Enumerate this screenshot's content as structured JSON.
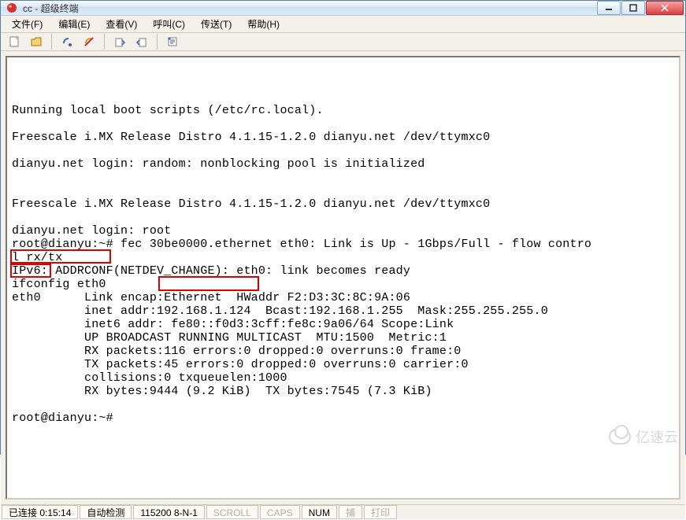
{
  "window": {
    "title": "cc - 超级终端"
  },
  "menu": {
    "file": "文件(F)",
    "edit": "编辑(E)",
    "view": "查看(V)",
    "call": "呼叫(C)",
    "transfer": "传送(T)",
    "help": "帮助(H)"
  },
  "toolbar_icons": {
    "new": "new-icon",
    "open": "open-icon",
    "connect": "connect-icon",
    "disconnect": "disconnect-icon",
    "send": "send-icon",
    "receive": "receive-icon",
    "properties": "properties-icon"
  },
  "terminal": {
    "lines": [
      "",
      "Running local boot scripts (/etc/rc.local).",
      "",
      "Freescale i.MX Release Distro 4.1.15-1.2.0 dianyu.net /dev/ttymxc0",
      "",
      "dianyu.net login: random: nonblocking pool is initialized",
      "",
      "",
      "Freescale i.MX Release Distro 4.1.15-1.2.0 dianyu.net /dev/ttymxc0",
      "",
      "dianyu.net login: root",
      "root@dianyu:~# fec 30be0000.ethernet eth0: Link is Up - 1Gbps/Full - flow contro",
      "l rx/tx",
      "IPv6: ADDRCONF(NETDEV_CHANGE): eth0: link becomes ready",
      "ifconfig eth0",
      "eth0      Link encap:Ethernet  HWaddr F2:D3:3C:8C:9A:06",
      "          inet addr:192.168.1.124  Bcast:192.168.1.255  Mask:255.255.255.0",
      "          inet6 addr: fe80::f0d3:3cff:fe8c:9a06/64 Scope:Link",
      "          UP BROADCAST RUNNING MULTICAST  MTU:1500  Metric:1",
      "          RX packets:116 errors:0 dropped:0 overruns:0 frame:0",
      "          TX packets:45 errors:0 dropped:0 overruns:0 carrier:0",
      "          collisions:0 txqueuelen:1000",
      "          RX bytes:9444 (9.2 KiB)  TX bytes:7545 (7.3 KiB)",
      "",
      "root@dianyu:~#"
    ],
    "highlights": {
      "ifconfig_cmd": "ifconfig eth0",
      "interface": "eth0",
      "ip_addr": "192.168.1.124"
    }
  },
  "status": {
    "connected": "已连接 0:15:14",
    "autodetect": "自动检测",
    "baud": "115200 8-N-1",
    "scroll": "SCROLL",
    "caps": "CAPS",
    "num": "NUM",
    "capture": "捕",
    "print": "打印"
  },
  "watermark": "亿速云"
}
